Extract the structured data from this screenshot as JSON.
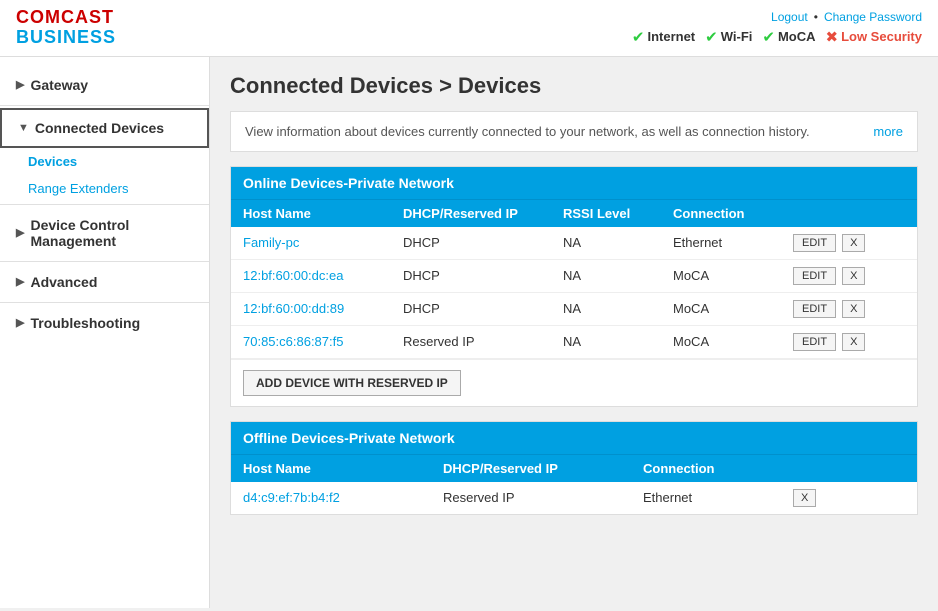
{
  "header": {
    "logo_comcast": "COMCAST",
    "logo_business": "BUSINESS",
    "links": {
      "logout": "Logout",
      "separator": "•",
      "change_password": "Change Password"
    },
    "status_items": [
      {
        "id": "internet",
        "label": "Internet",
        "ok": true
      },
      {
        "id": "wifi",
        "label": "Wi-Fi",
        "ok": true
      },
      {
        "id": "moca",
        "label": "MoCA",
        "ok": true
      },
      {
        "id": "security",
        "label": "Low Security",
        "ok": false
      }
    ]
  },
  "sidebar": {
    "items": [
      {
        "id": "gateway",
        "label": "Gateway",
        "arrow": "▶",
        "active": false
      },
      {
        "id": "connected-devices",
        "label": "Connected Devices",
        "arrow": "▼",
        "active": true
      },
      {
        "id": "devices-sub",
        "label": "Devices",
        "sub": true,
        "active": true
      },
      {
        "id": "range-extenders-sub",
        "label": "Range Extenders",
        "sub": true,
        "active": false
      },
      {
        "id": "device-control",
        "label": "Device Control Management",
        "arrow": "▶",
        "active": false
      },
      {
        "id": "advanced",
        "label": "Advanced",
        "arrow": "▶",
        "active": false
      },
      {
        "id": "troubleshooting",
        "label": "Troubleshooting",
        "arrow": "▶",
        "active": false
      }
    ]
  },
  "main": {
    "page_title": "Connected Devices > Devices",
    "info_text": "View information about devices currently connected to your network, as well as connection history.",
    "more_link": "more",
    "online_section": {
      "title": "Online Devices-Private Network",
      "columns": [
        "Host Name",
        "DHCP/Reserved IP",
        "RSSI Level",
        "Connection"
      ],
      "rows": [
        {
          "host": "Family-pc",
          "dhcp": "DHCP",
          "rssi": "NA",
          "connection": "Ethernet"
        },
        {
          "host": "12:bf:60:00:dc:ea",
          "dhcp": "DHCP",
          "rssi": "NA",
          "connection": "MoCA"
        },
        {
          "host": "12:bf:60:00:dd:89",
          "dhcp": "DHCP",
          "rssi": "NA",
          "connection": "MoCA"
        },
        {
          "host": "70:85:c6:86:87:f5",
          "dhcp": "Reserved IP",
          "rssi": "NA",
          "connection": "MoCA"
        }
      ],
      "add_button": "ADD DEVICE WITH RESERVED IP"
    },
    "offline_section": {
      "title": "Offline Devices-Private Network",
      "columns": [
        "Host Name",
        "DHCP/Reserved IP",
        "Connection"
      ],
      "rows": [
        {
          "host": "d4:c9:ef:7b:b4:f2",
          "dhcp": "Reserved IP",
          "connection": "Ethernet"
        }
      ]
    }
  }
}
